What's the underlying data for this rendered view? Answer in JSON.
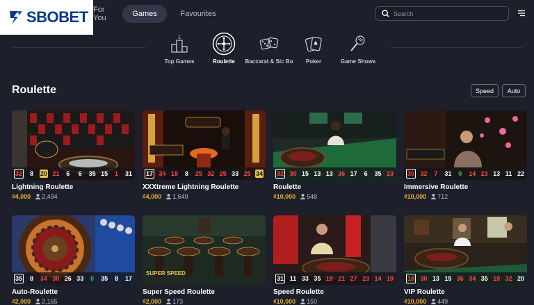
{
  "brand": {
    "name": "SBOBET"
  },
  "nav": {
    "tabs": [
      {
        "label": "For You"
      },
      {
        "label": "Games"
      },
      {
        "label": "Favourites"
      }
    ],
    "search_placeholder": "Search"
  },
  "categories": [
    {
      "label": "Top Games",
      "icon": "podium-icon"
    },
    {
      "label": "Roulette",
      "icon": "roulette-wheel-icon"
    },
    {
      "label": "Baccarat & Sic Bo",
      "icon": "dice-icon"
    },
    {
      "label": "Poker",
      "icon": "cards-icon"
    },
    {
      "label": "Game Shows",
      "icon": "microphone-icon"
    }
  ],
  "section": {
    "title": "Roulette",
    "filters": [
      "Speed",
      "Auto"
    ]
  },
  "colors": {
    "accent_bet": "#e8b32a",
    "red_number": "#ff4747",
    "green_number": "#35c25b",
    "background": "#1d1f2b"
  },
  "games": [
    {
      "title": "Lightning Roulette",
      "bet": "₫4,000",
      "players": "2,494",
      "numbers": [
        {
          "v": "32",
          "c": "red",
          "first": true
        },
        {
          "v": "8",
          "c": "white"
        },
        {
          "v": "20",
          "c": "gold"
        },
        {
          "v": "21",
          "c": "red"
        },
        {
          "v": "6",
          "c": "white"
        },
        {
          "v": "6",
          "c": "white"
        },
        {
          "v": "35",
          "c": "white"
        },
        {
          "v": "15",
          "c": "white"
        },
        {
          "v": "1",
          "c": "red"
        },
        {
          "v": "31",
          "c": "white"
        }
      ]
    },
    {
      "title": "XXXtreme Lightning Roulette",
      "bet": "₫4,000",
      "players": "1,649",
      "numbers": [
        {
          "v": "17",
          "c": "white",
          "first": true
        },
        {
          "v": "34",
          "c": "red"
        },
        {
          "v": "18",
          "c": "red"
        },
        {
          "v": "8",
          "c": "white"
        },
        {
          "v": "25",
          "c": "red"
        },
        {
          "v": "32",
          "c": "red"
        },
        {
          "v": "25",
          "c": "red"
        },
        {
          "v": "33",
          "c": "white"
        },
        {
          "v": "25",
          "c": "red"
        },
        {
          "v": "34",
          "c": "gold"
        }
      ]
    },
    {
      "title": "Roulette",
      "bet": "₫10,000",
      "players": "548",
      "numbers": [
        {
          "v": "32",
          "c": "red",
          "first": true
        },
        {
          "v": "30",
          "c": "red"
        },
        {
          "v": "15",
          "c": "white"
        },
        {
          "v": "13",
          "c": "white"
        },
        {
          "v": "13",
          "c": "white"
        },
        {
          "v": "36",
          "c": "red"
        },
        {
          "v": "17",
          "c": "white"
        },
        {
          "v": "6",
          "c": "white"
        },
        {
          "v": "35",
          "c": "white"
        },
        {
          "v": "23",
          "c": "red"
        }
      ]
    },
    {
      "title": "Immersive Roulette",
      "bet": "₫10,000",
      "players": "712",
      "numbers": [
        {
          "v": "30",
          "c": "red",
          "first": true
        },
        {
          "v": "32",
          "c": "red"
        },
        {
          "v": "7",
          "c": "red"
        },
        {
          "v": "31",
          "c": "white"
        },
        {
          "v": "0",
          "c": "green"
        },
        {
          "v": "14",
          "c": "red"
        },
        {
          "v": "23",
          "c": "red"
        },
        {
          "v": "13",
          "c": "white"
        },
        {
          "v": "11",
          "c": "white"
        },
        {
          "v": "22",
          "c": "white"
        }
      ]
    },
    {
      "title": "Auto-Roulette",
      "bet": "₫2,000",
      "players": "2,165",
      "numbers": [
        {
          "v": "35",
          "c": "white",
          "first": true
        },
        {
          "v": "8",
          "c": "white"
        },
        {
          "v": "34",
          "c": "red"
        },
        {
          "v": "30",
          "c": "red"
        },
        {
          "v": "26",
          "c": "white"
        },
        {
          "v": "33",
          "c": "white"
        },
        {
          "v": "0",
          "c": "green"
        },
        {
          "v": "35",
          "c": "white"
        },
        {
          "v": "8",
          "c": "white"
        },
        {
          "v": "17",
          "c": "white"
        }
      ]
    },
    {
      "title": "Super Speed Roulette",
      "bet": "₫2,000",
      "players": "173",
      "numbers": []
    },
    {
      "title": "Speed Roulette",
      "bet": "₫10,000",
      "players": "150",
      "numbers": [
        {
          "v": "31",
          "c": "white",
          "first": true
        },
        {
          "v": "11",
          "c": "white"
        },
        {
          "v": "33",
          "c": "white"
        },
        {
          "v": "35",
          "c": "white"
        },
        {
          "v": "19",
          "c": "red"
        },
        {
          "v": "21",
          "c": "red"
        },
        {
          "v": "27",
          "c": "red"
        },
        {
          "v": "23",
          "c": "red"
        },
        {
          "v": "14",
          "c": "red"
        },
        {
          "v": "19",
          "c": "red"
        }
      ]
    },
    {
      "title": "VIP Roulette",
      "bet": "₫10,000",
      "players": "449",
      "numbers": [
        {
          "v": "18",
          "c": "red",
          "first": true
        },
        {
          "v": "30",
          "c": "red"
        },
        {
          "v": "13",
          "c": "white"
        },
        {
          "v": "15",
          "c": "white"
        },
        {
          "v": "36",
          "c": "red"
        },
        {
          "v": "34",
          "c": "red"
        },
        {
          "v": "35",
          "c": "white"
        },
        {
          "v": "19",
          "c": "red"
        },
        {
          "v": "32",
          "c": "red"
        },
        {
          "v": "20",
          "c": "white"
        }
      ]
    }
  ]
}
